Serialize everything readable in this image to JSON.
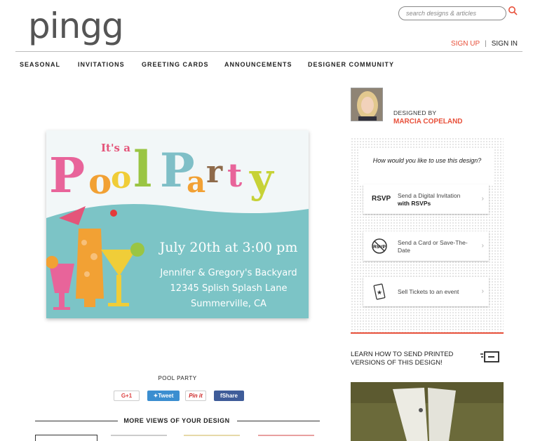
{
  "brand": {
    "logo_text": "pingg",
    "accent": "#e8503a"
  },
  "search": {
    "placeholder": "search designs & articles"
  },
  "auth": {
    "sign_up": "SIGN UP",
    "separator": "|",
    "sign_in": "SIGN IN"
  },
  "nav": [
    "SEASONAL",
    "INVITATIONS",
    "GREETING CARDS",
    "ANNOUNCEMENTS",
    "DESIGNER COMMUNITY"
  ],
  "card": {
    "small_title": "It's a",
    "title_word1": "Pool",
    "title_word2": "Party",
    "date_line": "July 20th at 3:00 pm",
    "line1": "Jennifer & Gregory's Backyard",
    "line2": "12345 Splish Splash Lane",
    "line3": "Summerville, CA"
  },
  "design_name": "POOL PARTY",
  "share": {
    "gplus": "G+1",
    "tweet": "Tweet",
    "pin": "Pin it",
    "fb": "Share"
  },
  "more_views": "MORE VIEWS OF YOUR DESIGN",
  "designer": {
    "designed_by": "DESIGNED BY",
    "name": "MARCIA COPELAND"
  },
  "options": {
    "question": "How would you like to use this design?",
    "rsvp_badge": "RSVP",
    "opt1_line1": "Send a Digital Invitation",
    "opt1_line2": "with RSVPs",
    "opt2": "Send a Card or Save-The-Date",
    "opt3": "Sell Tickets to an event"
  },
  "learn": "LEARN HOW TO SEND PRINTED VERSIONS OF THIS DESIGN!"
}
